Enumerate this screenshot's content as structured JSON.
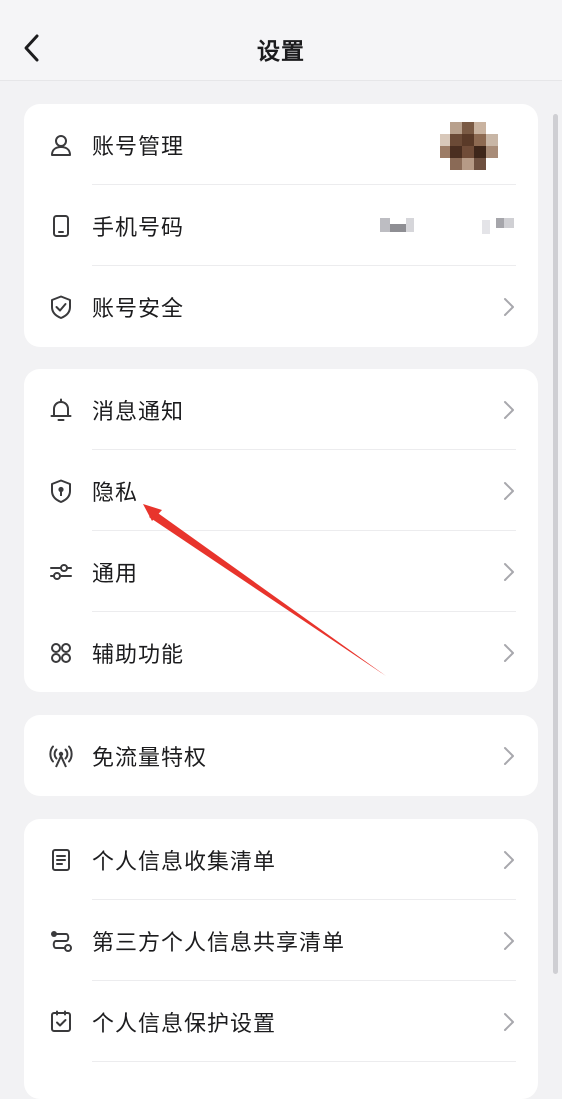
{
  "header": {
    "title": "设置",
    "back_icon": "chevron-left-icon"
  },
  "groups": [
    {
      "items": [
        {
          "label": "账号管理",
          "icon": "user-icon",
          "trailing": "avatar"
        },
        {
          "label": "手机号码",
          "icon": "phone-icon",
          "trailing": "masked-phone"
        },
        {
          "label": "账号安全",
          "icon": "shield-check-icon",
          "trailing": "chevron"
        }
      ]
    },
    {
      "items": [
        {
          "label": "消息通知",
          "icon": "bell-icon",
          "trailing": "chevron"
        },
        {
          "label": "隐私",
          "icon": "privacy-shield-icon",
          "trailing": "chevron"
        },
        {
          "label": "通用",
          "icon": "sliders-icon",
          "trailing": "chevron"
        },
        {
          "label": "辅助功能",
          "icon": "grid-icon",
          "trailing": "chevron"
        }
      ]
    },
    {
      "items": [
        {
          "label": "免流量特权",
          "icon": "signal-tower-icon",
          "trailing": "chevron"
        }
      ]
    },
    {
      "items": [
        {
          "label": "个人信息收集清单",
          "icon": "document-list-icon",
          "trailing": "chevron"
        },
        {
          "label": "第三方个人信息共享清单",
          "icon": "share-flow-icon",
          "trailing": "chevron"
        },
        {
          "label": "个人信息保护设置",
          "icon": "checkbox-doc-icon",
          "trailing": "chevron"
        }
      ]
    }
  ],
  "annotation": {
    "type": "red-arrow",
    "points_to": "隐私",
    "color": "#e8342c"
  }
}
